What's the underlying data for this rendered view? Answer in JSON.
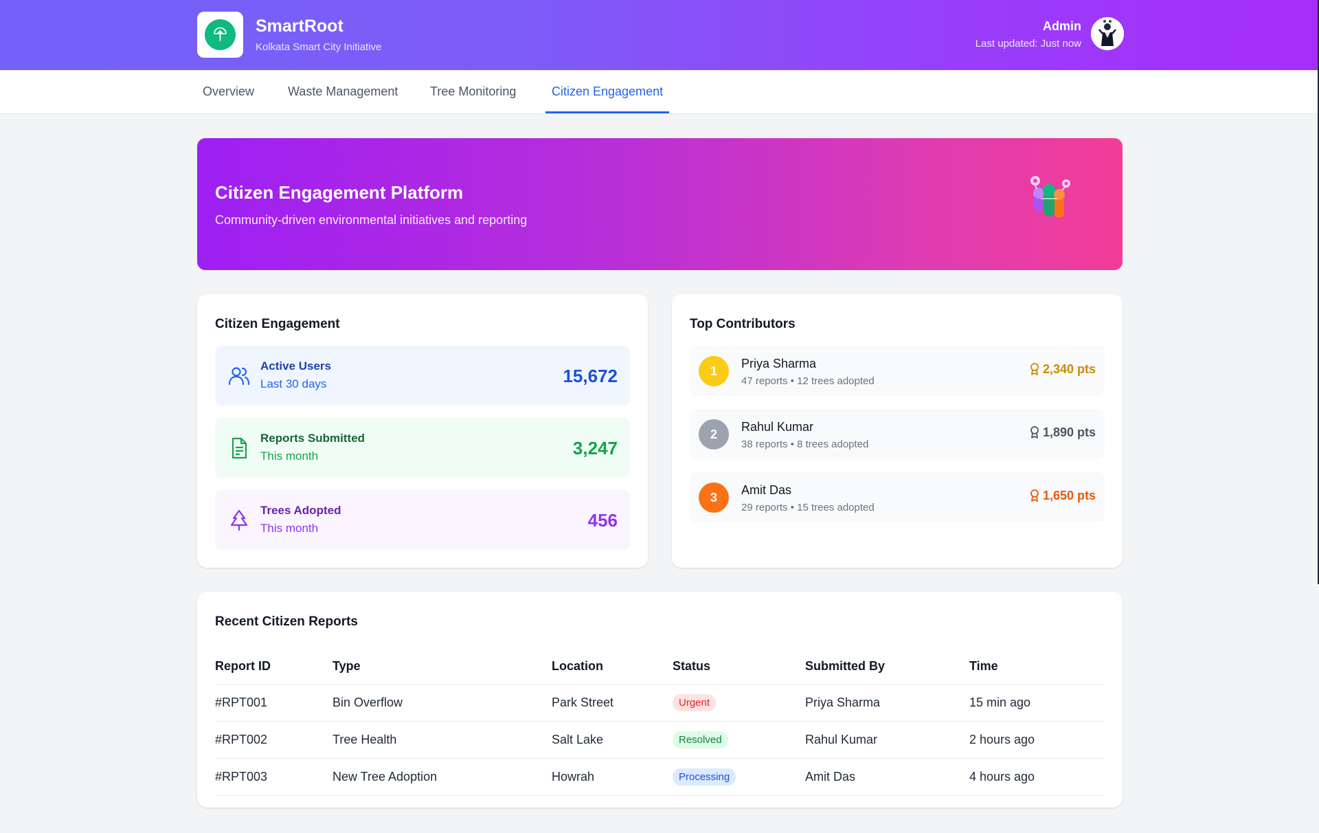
{
  "header": {
    "app_name": "SmartRoot",
    "subtitle": "Kolkata Smart City Initiative",
    "user_name": "Admin",
    "last_updated": "Last updated: Just now"
  },
  "nav": {
    "tabs": [
      {
        "label": "Overview"
      },
      {
        "label": "Waste Management"
      },
      {
        "label": "Tree Monitoring"
      },
      {
        "label": "Citizen Engagement",
        "active": true
      }
    ]
  },
  "hero": {
    "title": "Citizen Engagement Platform",
    "subtitle": "Community-driven environmental initiatives and reporting"
  },
  "engagement": {
    "title": "Citizen Engagement",
    "stats": [
      {
        "label": "Active Users",
        "sub": "Last 30 days",
        "value": "15,672",
        "icon": "users-icon",
        "color": "#2563eb",
        "bg": "#eff6ff"
      },
      {
        "label": "Reports Submitted",
        "sub": "This month",
        "value": "3,247",
        "icon": "document-icon",
        "color": "#16a34a",
        "bg": "#f0fdf4"
      },
      {
        "label": "Trees Adopted",
        "sub": "This month",
        "value": "456",
        "icon": "tree-icon",
        "color": "#9333ea",
        "bg": "#faf5ff"
      }
    ]
  },
  "contributors": {
    "title": "Top Contributors",
    "items": [
      {
        "rank": "1",
        "name": "Priya Sharma",
        "meta": "47 reports • 12 trees adopted",
        "points": "2,340 pts",
        "rank_color": "#facc15",
        "points_color": "#ca8a04"
      },
      {
        "rank": "2",
        "name": "Rahul Kumar",
        "meta": "38 reports • 8 trees adopted",
        "points": "1,890 pts",
        "rank_color": "#9ca3af",
        "points_color": "#4b5563"
      },
      {
        "rank": "3",
        "name": "Amit Das",
        "meta": "29 reports • 15 trees adopted",
        "points": "1,650 pts",
        "rank_color": "#f97316",
        "points_color": "#ea580c"
      }
    ]
  },
  "reports": {
    "title": "Recent Citizen Reports",
    "columns": [
      "Report ID",
      "Type",
      "Location",
      "Status",
      "Submitted By",
      "Time"
    ],
    "rows": [
      {
        "id": "#RPT001",
        "type": "Bin Overflow",
        "location": "Park Street",
        "status": "Urgent",
        "status_color": "#dc2626",
        "status_bg": "#fee2e2",
        "by": "Priya Sharma",
        "time": "15 min ago"
      },
      {
        "id": "#RPT002",
        "type": "Tree Health",
        "location": "Salt Lake",
        "status": "Resolved",
        "status_color": "#15803d",
        "status_bg": "#dcfce7",
        "by": "Rahul Kumar",
        "time": "2 hours ago"
      },
      {
        "id": "#RPT003",
        "type": "New Tree Adoption",
        "location": "Howrah",
        "status": "Processing",
        "status_color": "#1d4ed8",
        "status_bg": "#dbeafe",
        "by": "Amit Das",
        "time": "4 hours ago"
      }
    ]
  }
}
